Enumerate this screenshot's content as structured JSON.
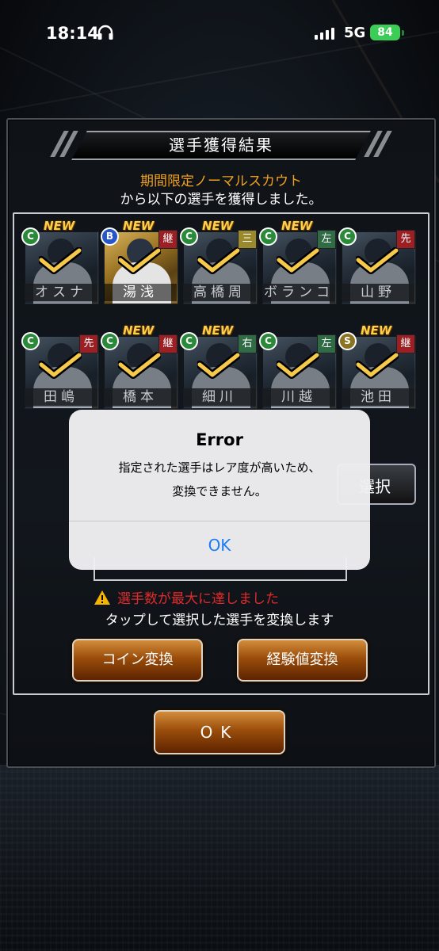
{
  "status_bar": {
    "time": "18:14",
    "network": "5G",
    "battery": "84"
  },
  "dialog": {
    "title": "選手獲得結果",
    "scout_name": "期間限定ノーマルスカウト",
    "scout_message": "から以下の選手を獲得しました。"
  },
  "players": [
    {
      "name": "オスナ",
      "rank": "C",
      "position": "",
      "new": true
    },
    {
      "name": "湯浅",
      "rank": "B",
      "position": "継",
      "new": true
    },
    {
      "name": "高橋周",
      "rank": "C",
      "position": "三",
      "new": true
    },
    {
      "name": "ボランコ",
      "rank": "C",
      "position": "左",
      "new": true
    },
    {
      "name": "山野",
      "rank": "C",
      "position": "先",
      "new": false
    },
    {
      "name": "田嶋",
      "rank": "C",
      "position": "先",
      "new": false
    },
    {
      "name": "橋本",
      "rank": "C",
      "position": "継",
      "new": true
    },
    {
      "name": "細川",
      "rank": "C",
      "position": "右",
      "new": true
    },
    {
      "name": "川越",
      "rank": "C",
      "position": "左",
      "new": false
    },
    {
      "name": "池田",
      "rank": "S",
      "position": "継",
      "new": true
    }
  ],
  "new_label": "NEW",
  "select_button": "選択",
  "warning": "選手数が最大に達しました",
  "hint": "タップして選択した選手を変換します",
  "buttons": {
    "coin": "コイン変換",
    "exp": "経験値変換",
    "ok": "OK"
  },
  "alert": {
    "title": "Error",
    "line1": "指定された選手はレア度が高いため、",
    "line2": "変換できません。",
    "ok": "OK",
    "ok_color": "#1a7cf5"
  },
  "colors": {
    "scout_name": "#f0a020",
    "warning": "#e02a2a",
    "battery": "#3bcd55"
  }
}
